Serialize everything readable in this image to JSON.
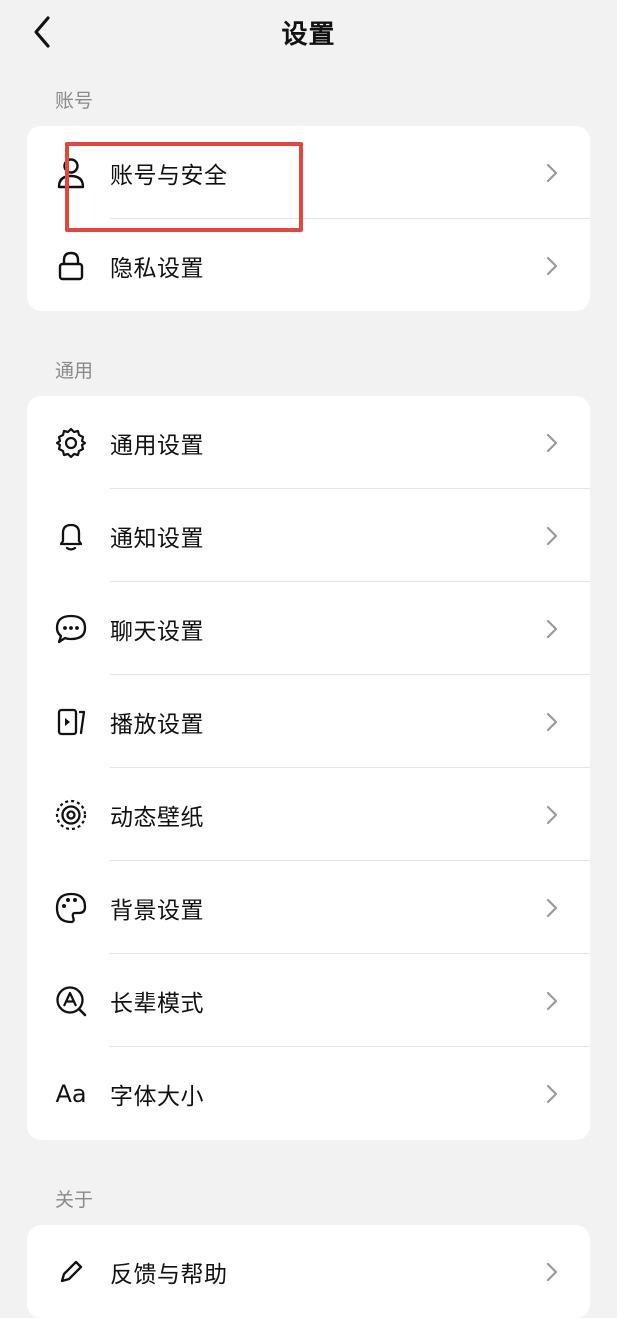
{
  "header": {
    "title": "设置",
    "back_icon": "chevron-left-icon"
  },
  "sections": [
    {
      "label": "账号",
      "items": [
        {
          "label": "账号与安全",
          "icon": "user-icon"
        },
        {
          "label": "隐私设置",
          "icon": "lock-icon"
        }
      ]
    },
    {
      "label": "通用",
      "items": [
        {
          "label": "通用设置",
          "icon": "gear-icon"
        },
        {
          "label": "通知设置",
          "icon": "bell-icon"
        },
        {
          "label": "聊天设置",
          "icon": "chat-bubble-icon"
        },
        {
          "label": "播放设置",
          "icon": "play-icon"
        },
        {
          "label": "动态壁纸",
          "icon": "concentric-circle-icon"
        },
        {
          "label": "背景设置",
          "icon": "palette-icon"
        },
        {
          "label": "长辈模式",
          "icon": "elder-mode-icon"
        },
        {
          "label": "字体大小",
          "icon": "font-size-icon",
          "icon_text": "Aa"
        }
      ]
    },
    {
      "label": "关于",
      "items": [
        {
          "label": "反馈与帮助",
          "icon": "pencil-icon"
        }
      ]
    }
  ],
  "highlight_color": "#e2463d"
}
